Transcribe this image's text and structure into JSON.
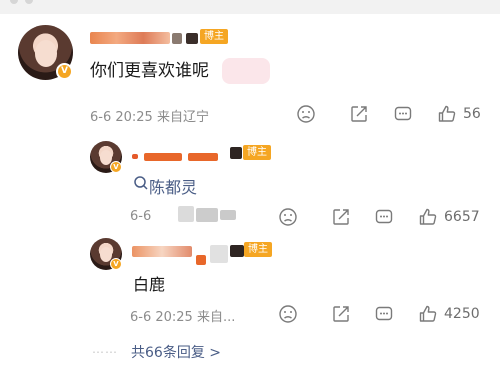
{
  "main_comment": {
    "badge": "博主",
    "text": "你们更喜欢谁呢",
    "time_location": "6-6 20:25 来自辽宁",
    "likes": "56"
  },
  "replies": [
    {
      "badge": "博主",
      "link_text": "陈都灵",
      "time_location": "6-6",
      "likes": "6657"
    },
    {
      "badge": "博主",
      "text": "白鹿",
      "time_location": "6-6 20:25 来自...",
      "likes": "4250"
    }
  ],
  "view_more": "共66条回复 >",
  "icons": [
    "dislike-icon",
    "share-icon",
    "comment-icon",
    "like-icon",
    "search-icon",
    "verified-icon"
  ],
  "colors": {
    "badge": "#f5a623",
    "link": "#4a5d86",
    "meta": "#8c8c8c",
    "redact_orange": "#e8672a"
  }
}
